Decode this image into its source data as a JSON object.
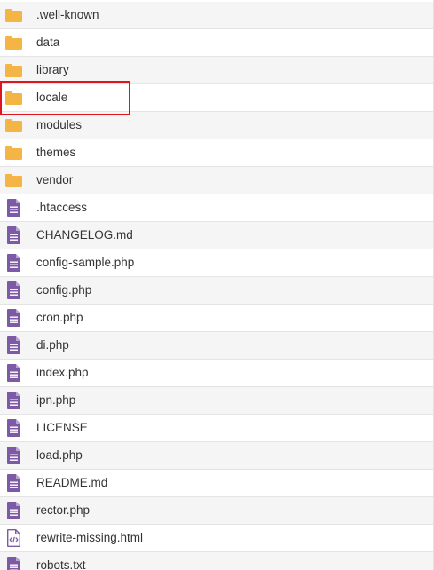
{
  "colors": {
    "folder": "#f4b446",
    "file": "#7c5aa6",
    "highlight": "#e0141e"
  },
  "highlighted_item": "locale",
  "items": [
    {
      "name": ".well-known",
      "type": "folder",
      "icon": "folder-icon"
    },
    {
      "name": "data",
      "type": "folder",
      "icon": "folder-icon"
    },
    {
      "name": "library",
      "type": "folder",
      "icon": "folder-icon"
    },
    {
      "name": "locale",
      "type": "folder",
      "icon": "folder-icon"
    },
    {
      "name": "modules",
      "type": "folder",
      "icon": "folder-icon"
    },
    {
      "name": "themes",
      "type": "folder",
      "icon": "folder-icon"
    },
    {
      "name": "vendor",
      "type": "folder",
      "icon": "folder-icon"
    },
    {
      "name": ".htaccess",
      "type": "file",
      "icon": "file-text-icon"
    },
    {
      "name": "CHANGELOG.md",
      "type": "file",
      "icon": "file-text-icon"
    },
    {
      "name": "config-sample.php",
      "type": "file",
      "icon": "file-text-icon"
    },
    {
      "name": "config.php",
      "type": "file",
      "icon": "file-text-icon"
    },
    {
      "name": "cron.php",
      "type": "file",
      "icon": "file-text-icon"
    },
    {
      "name": "di.php",
      "type": "file",
      "icon": "file-text-icon"
    },
    {
      "name": "index.php",
      "type": "file",
      "icon": "file-text-icon"
    },
    {
      "name": "ipn.php",
      "type": "file",
      "icon": "file-text-icon"
    },
    {
      "name": "LICENSE",
      "type": "file",
      "icon": "file-text-icon"
    },
    {
      "name": "load.php",
      "type": "file",
      "icon": "file-text-icon"
    },
    {
      "name": "README.md",
      "type": "file",
      "icon": "file-text-icon"
    },
    {
      "name": "rector.php",
      "type": "file",
      "icon": "file-text-icon"
    },
    {
      "name": "rewrite-missing.html",
      "type": "file",
      "icon": "file-code-icon"
    },
    {
      "name": "robots.txt",
      "type": "file",
      "icon": "file-text-icon"
    }
  ]
}
